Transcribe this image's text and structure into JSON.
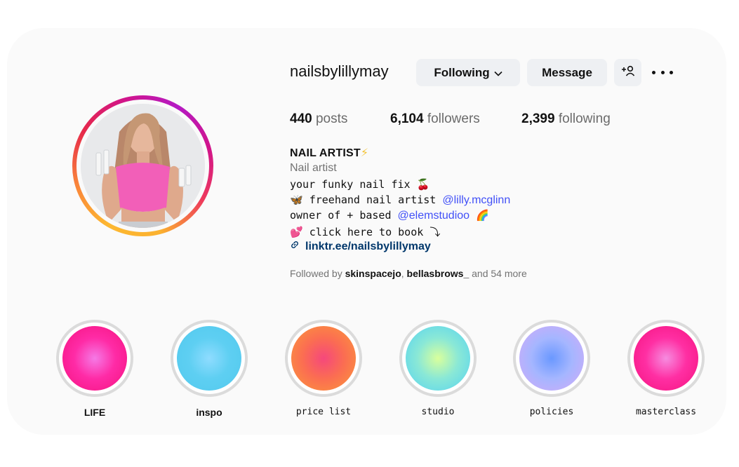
{
  "profile": {
    "username": "nailsbylillymay",
    "buttons": {
      "following_label": "Following",
      "message_label": "Message"
    },
    "stats": {
      "posts_count": "440",
      "posts_label": "posts",
      "followers_count": "6,104",
      "followers_label": "followers",
      "following_count": "2,399",
      "following_label": "following"
    },
    "bio": {
      "title": "NAIL ARTIST",
      "title_emoji": "⚡",
      "category": "Nail artist",
      "line1_text": "your funky nail fix",
      "line1_emoji": "🍒",
      "line2_emoji": "🦋",
      "line2_text": "freehand nail artist",
      "line2_mention": "@lilly.mcglinn",
      "line3_text": "owner of + based",
      "line3_mention": "@elemstudioo",
      "line3_emoji": "🌈",
      "line4_emoji": "💕",
      "line4_text": "click here to book",
      "line4_arrow": "⤵",
      "link": "linktr.ee/nailsbylillymay"
    },
    "followed_by": {
      "prefix": "Followed by",
      "user1": "skinspacejo",
      "separator": ",",
      "user2": "bellasbrows_",
      "suffix": "and 54 more"
    }
  },
  "highlights": [
    {
      "label": "LIFE",
      "colors": [
        "#f57ae6",
        "#ff2ba6",
        "#f5127f"
      ]
    },
    {
      "label": "inspo",
      "colors": [
        "#8fdcff",
        "#5ecff2",
        "#52c9ee"
      ]
    },
    {
      "label": "price list",
      "colors": [
        "#f5487c",
        "#fb6d52",
        "#fb9b39"
      ]
    },
    {
      "label": "studio",
      "colors": [
        "#d9ff9c",
        "#8ae8d6",
        "#54d2f2"
      ]
    },
    {
      "label": "policies",
      "colors": [
        "#6a98ff",
        "#a5b6ff",
        "#d5aaf8"
      ]
    },
    {
      "label": "masterclass",
      "colors": [
        "#f68ce0",
        "#ff2fa3",
        "#f5127f"
      ]
    }
  ],
  "icons": {
    "following_chevron": "chevron-down-icon",
    "add_user": "add-person-icon",
    "more": "more-options-icon",
    "link": "link-icon"
  }
}
